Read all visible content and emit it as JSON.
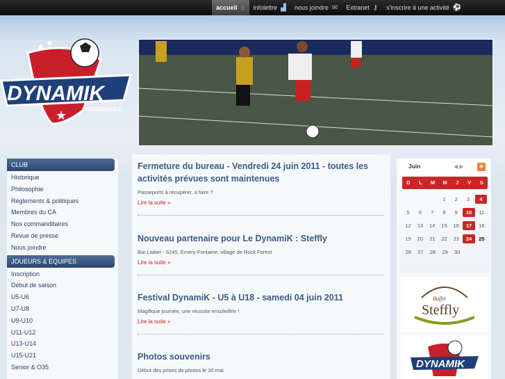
{
  "nav": [
    {
      "label": "accueil",
      "icon": "home-icon",
      "glyph": "⌂",
      "active": true
    },
    {
      "label": "infolettre",
      "icon": "sitemap-icon",
      "glyph": "▟",
      "active": false
    },
    {
      "label": "nous joindre",
      "icon": "envelope-icon",
      "glyph": "✉",
      "active": false
    },
    {
      "label": "Extranet",
      "icon": "key-icon",
      "glyph": "⚷",
      "active": false
    },
    {
      "label": "s'inscrire à une activité",
      "icon": "soccer-ball-icon",
      "glyph": "⚽",
      "active": false
    }
  ],
  "logo": {
    "name": "DYNAMIK",
    "city": "SHERBROOKE"
  },
  "sidebar": {
    "club_title": "CLUB",
    "club_items": [
      "Historique",
      "Philosophie",
      "Règlements & politiques",
      "Membres du CA",
      "Nos commanditaires",
      "Revue de presse",
      "Nous joindre"
    ],
    "teams_title": "JOUEURS & ÉQUIPES",
    "teams_items": [
      "Inscription",
      "Début de saison",
      "U5-U6",
      "U7-U8",
      "U9-U10",
      "U11-U12",
      "U13-U14",
      "U15-U21",
      "Senior & O35"
    ]
  },
  "posts": [
    {
      "title": "Fermeture du bureau - Vendredi 24 juin 2011 - toutes les activités prévues sont maintenues",
      "summary": "Passeports à récupérer, à faire ?",
      "more": "Lire la suite »"
    },
    {
      "title": "Nouveau partenaire pour Le DynamiK : Steffly",
      "summary": "Bar Laitier - 6245, Émery-Fontaine, village de Rock Forest",
      "more": "Lire la suite »"
    },
    {
      "title": "Festival DynamiK - U5 à U18 - samedi 04 juin 2011",
      "summary": "Magifique journée, une réussite ensoleillée !",
      "more": "Lire la suite »"
    },
    {
      "title": "Photos souvenirs",
      "summary": "Début des prises de photos le 30 mai",
      "more": ""
    }
  ],
  "calendar": {
    "month": "Juin",
    "days": [
      "D",
      "L",
      "M",
      "M",
      "J",
      "V",
      "S"
    ],
    "weeks": [
      [
        "",
        "",
        "",
        "1",
        "2",
        "3",
        "4"
      ],
      [
        "5",
        "6",
        "7",
        "8",
        "9",
        "10",
        "11"
      ],
      [
        "12",
        "13",
        "14",
        "15",
        "16",
        "17",
        "18"
      ],
      [
        "19",
        "20",
        "21",
        "22",
        "23",
        "24",
        "25"
      ],
      [
        "26",
        "27",
        "28",
        "29",
        "30",
        "",
        ""
      ]
    ],
    "highlighted": [
      "4",
      "10",
      "17",
      "24"
    ],
    "today": "25"
  },
  "sponsor": {
    "name": "Steffly",
    "tag": "Buffet"
  },
  "colors": {
    "accent": "#cc2525",
    "link": "#3a5a86",
    "sidebar_head": "#2c4670"
  }
}
